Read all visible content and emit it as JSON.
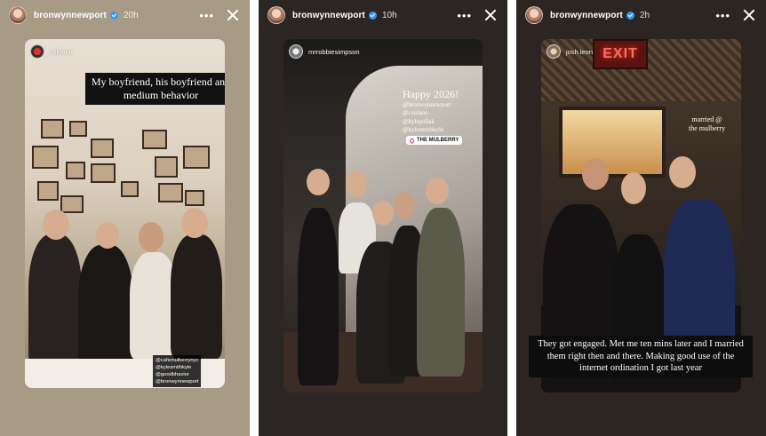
{
  "stories": [
    {
      "author": "bronwynnewport",
      "time": "20h",
      "reposted_from": "csiriano",
      "caption": "My boyfriend, his boyfriend and medium behavior",
      "tags": [
        "@cafemulberrynyc",
        "@kylesmithkyle",
        "@goodbhavior",
        "@bronwynnewport"
      ]
    },
    {
      "author": "bronwynnewport",
      "time": "10h",
      "reposted_from": "mrrobbiesimpson",
      "title": "Happy 2026!",
      "mentions": [
        "@bronwynnewport",
        "@csiriano",
        "@kylepollak",
        "@kylesmithkyle"
      ],
      "location": "THE MULBERRY"
    },
    {
      "author": "bronwynnewport",
      "time": "2h",
      "reposted_from": "josh.leon",
      "sign_text": "EXIT",
      "note": "married @\nthe mulberry",
      "caption": "They got engaged. Met me ten mins later and I married them right then and there. Making good use of the internet ordination I got last year"
    }
  ],
  "controls": {
    "more": "•••"
  },
  "colors": {
    "verified": "#3897f0",
    "overlay": "#111111"
  }
}
